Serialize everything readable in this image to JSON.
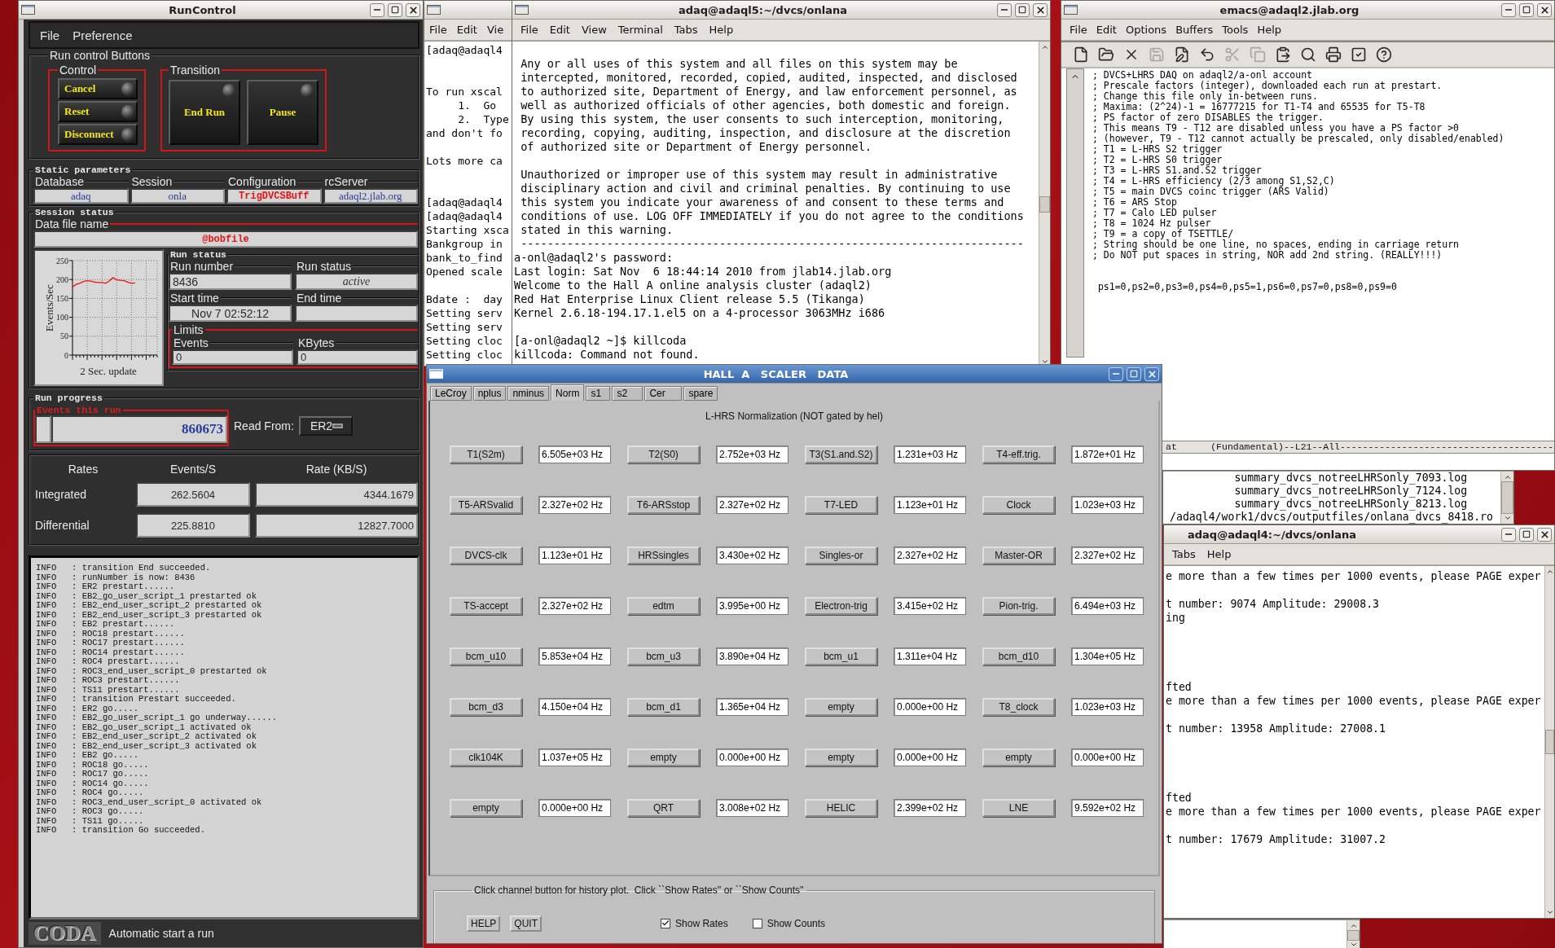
{
  "run_control": {
    "title": "RunControl",
    "menu": [
      "File",
      "Preference"
    ],
    "buttons_section": "Run control Buttons",
    "control": {
      "title": "Control",
      "buttons": [
        "Cancel",
        "Reset",
        "Disconnect"
      ]
    },
    "transition": {
      "title": "Transition",
      "buttons": [
        "End Run",
        "Pause"
      ]
    },
    "static_parameters": {
      "title": "Static parameters",
      "fields": [
        {
          "label": "Database",
          "value": "adaq",
          "emphasis": false
        },
        {
          "label": "Session",
          "value": "onla",
          "emphasis": false
        },
        {
          "label": "Configuration",
          "value": "TrigDVCSBuff",
          "emphasis": true
        },
        {
          "label": "rcServer",
          "value": "adaql2.jlab.org",
          "emphasis": false
        }
      ]
    },
    "session_status": {
      "title": "Session status",
      "data_file": {
        "label": "Data file name",
        "value": "@bobfile",
        "emphasis": true
      }
    },
    "rate_chart": {
      "chart_data": {
        "type": "line",
        "grid": true,
        "ylabel": "Events/Sec",
        "xlabel": "2 Sec. update",
        "categories": [
          null,
          null,
          null,
          null,
          null,
          null,
          null,
          null,
          null,
          null,
          null,
          null,
          null,
          null,
          null,
          null,
          null,
          null,
          null,
          null,
          null,
          null,
          null,
          null
        ],
        "values": [
          180,
          187,
          190,
          195,
          197,
          196,
          193,
          192,
          192,
          190,
          196,
          205,
          199,
          198,
          197,
          193,
          190,
          191,
          null,
          null,
          null,
          null,
          null,
          null
        ],
        "ylim": [
          0,
          250
        ],
        "yticks": [
          0,
          50,
          100,
          150,
          200,
          250
        ]
      }
    },
    "run_status": {
      "title": "Run status",
      "fields": [
        {
          "label": "Run number",
          "value": "8436",
          "kind": "number"
        },
        {
          "label": "Run status",
          "value": "active",
          "kind": "state"
        },
        {
          "label": "Start time",
          "value": "Nov 7 02:52:12",
          "kind": "time"
        },
        {
          "label": "End time",
          "kind": "time"
        }
      ]
    },
    "limits": {
      "title": "Limits",
      "fields": [
        {
          "label": "Events",
          "value": "0"
        },
        {
          "label": "KBytes",
          "value": "0"
        }
      ]
    },
    "run_progress": {
      "title": "Run progress",
      "events_label": "Events this run",
      "events_value": "860673",
      "read_from_label": "Read From:",
      "read_from_value": "ER2"
    },
    "rates": {
      "columns": [
        "Rates",
        "Events/S",
        "Rate (KB/S)"
      ],
      "rows": [
        {
          "name": "Integrated",
          "events": "262.5604",
          "rate": "4344.1679"
        },
        {
          "name": "Differential",
          "events": "225.8810",
          "rate": "12827.7000"
        }
      ]
    },
    "log": [
      "INFO   : transition End succeeded.",
      "INFO   : runNumber is now: 8436",
      "INFO   : ER2 prestart......",
      "INFO   : EB2_go_user_script_1 prestarted ok",
      "INFO   : EB2_end_user_script_2 prestarted ok",
      "INFO   : EB2_end_user_script_3 prestarted ok",
      "INFO   : EB2 prestart......",
      "INFO   : ROC18 prestart......",
      "INFO   : ROC17 prestart......",
      "INFO   : ROC14 prestart......",
      "INFO   : ROC4 prestart......",
      "INFO   : ROC3_end_user_script_0 prestarted ok",
      "INFO   : ROC3 prestart......",
      "INFO   : TS11 prestart......",
      "INFO   : transition Prestart succeeded.",
      "INFO   : ER2 go.....",
      "INFO   : EB2_go_user_script_1 go underway......",
      "INFO   : EB2_go_user_script_1 activated ok",
      "INFO   : EB2_end_user_script_2 activated ok",
      "INFO   : EB2_end_user_script_3 activated ok",
      "INFO   : EB2 go.....",
      "INFO   : ROC18 go.....",
      "INFO   : ROC17 go.....",
      "INFO   : ROC14 go.....",
      "INFO   : ROC4 go.....",
      "INFO   : ROC3_end_user_script_0 activated ok",
      "INFO   : ROC3 go.....",
      "INFO   : TS11 go.....",
      "INFO   : transition Go succeeded."
    ],
    "logo": "CODA",
    "status": "Automatic start a run"
  },
  "xterm_behind": {
    "menu": [
      "File",
      "Edit",
      "Vie"
    ],
    "lines": [
      {
        "kind": "text",
        "text": "[adaq@adaql4"
      },
      {
        "kind": "blank"
      },
      {
        "kind": "blank"
      },
      {
        "kind": "text",
        "text": "To run xscal"
      },
      {
        "kind": "text",
        "text": "     1.  Go"
      },
      {
        "kind": "text",
        "text": "     2.  Type"
      },
      {
        "kind": "text",
        "text": "and don't fo"
      },
      {
        "kind": "blank"
      },
      {
        "kind": "text",
        "text": "Lots more ca"
      },
      {
        "kind": "blank"
      },
      {
        "kind": "blank"
      },
      {
        "kind": "text",
        "text": "[adaq@adaql4"
      },
      {
        "kind": "text",
        "text": "[adaq@adaql4"
      },
      {
        "kind": "text",
        "text": "Starting xsca"
      },
      {
        "kind": "text",
        "text": "Bankgroup in"
      },
      {
        "kind": "text",
        "text": "bank_to_find"
      },
      {
        "kind": "text",
        "text": "Opened scale"
      },
      {
        "kind": "blank"
      },
      {
        "kind": "text",
        "text": "Bdate :  day"
      },
      {
        "kind": "text",
        "text": "Setting serv"
      },
      {
        "kind": "text",
        "text": "Setting serv"
      },
      {
        "kind": "text",
        "text": "Setting cloc"
      },
      {
        "kind": "text",
        "text": "Setting cloc"
      }
    ]
  },
  "terminal": {
    "title": "adaq@adaql5:~/dvcs/onlana",
    "menu": [
      "File",
      "Edit",
      "View",
      "Terminal",
      "Tabs",
      "Help"
    ],
    "lines": [
      {
        "kind": "blank"
      },
      {
        "kind": "text",
        "text": " Any or all uses of this system and all files on this system may be"
      },
      {
        "kind": "text",
        "text": " intercepted, monitored, recorded, copied, audited, inspected, and disclosed"
      },
      {
        "kind": "text",
        "text": " to authorized site, Department of Energy, and law enforcement personnel, as"
      },
      {
        "kind": "text",
        "text": " well as authorized officials of other agencies, both domestic and foreign."
      },
      {
        "kind": "text",
        "text": " By using this system, the user consents to such interception, monitoring,"
      },
      {
        "kind": "text",
        "text": " recording, copying, auditing, inspection, and disclosure at the discretion"
      },
      {
        "kind": "text",
        "text": " of authorized site or Department of Energy personnel."
      },
      {
        "kind": "blank"
      },
      {
        "kind": "text",
        "text": " Unauthorized or improper use of this system may result in administrative"
      },
      {
        "kind": "text",
        "text": " disciplinary action and civil and criminal penalties. By continuing to use"
      },
      {
        "kind": "text",
        "text": " this system you indicate your awareness of and consent to these terms and"
      },
      {
        "kind": "text",
        "text": " conditions of use. LOG OFF IMMEDIATELY if you do not agree to the conditions"
      },
      {
        "kind": "text",
        "text": " stated in this warning."
      },
      {
        "kind": "text",
        "text": " ----------------------------------------------------------------------------"
      },
      {
        "kind": "text",
        "text": "a-onl@adaql2's password:"
      },
      {
        "kind": "text",
        "text": "Last login: Sat Nov  6 18:44:14 2010 from jlab14.jlab.org"
      },
      {
        "kind": "text",
        "text": "Welcome to the Hall A online analysis cluster (adaql2)"
      },
      {
        "kind": "text",
        "text": "Red Hat Enterprise Linux Client release 5.5 (Tikanga)"
      },
      {
        "kind": "text",
        "text": "Kernel 2.6.18-194.17.1.el5 on a 4-processor 3063MHz i686"
      },
      {
        "kind": "blank"
      },
      {
        "kind": "text",
        "text": "[a-onl@adaql2 ~]$ killcoda"
      },
      {
        "kind": "text",
        "text": "killcoda: Command not found."
      }
    ]
  },
  "emacs": {
    "title": "emacs@adaql2.jlab.org",
    "menu": [
      "File",
      "Edit",
      "Options",
      "Buffers",
      "Tools",
      "Help"
    ],
    "toolbar": [
      {
        "disabled": false
      },
      {
        "disabled": false
      },
      {
        "disabled": false
      },
      {
        "disabled": true
      },
      {
        "disabled": false
      },
      {
        "disabled": false
      },
      {
        "disabled": true
      },
      {
        "disabled": true
      },
      {
        "disabled": false
      },
      {
        "disabled": false
      },
      {
        "disabled": false
      },
      {
        "disabled": false
      },
      {
        "disabled": false
      }
    ],
    "lines": [
      {
        "kind": "text",
        "text": "; DVCS+LHRS DAQ on adaql2/a-onl account"
      },
      {
        "kind": "text",
        "text": "; Prescale factors (integer), downloaded each run at prestart."
      },
      {
        "kind": "text",
        "text": "; Change this file only in-between runs."
      },
      {
        "kind": "text",
        "text": "; Maxima: (2^24)-1 = 16777215 for T1-T4 and 65535 for T5-T8"
      },
      {
        "kind": "text",
        "text": "; PS factor of zero DISABLES the trigger."
      },
      {
        "kind": "text",
        "text": "; This means T9 - T12 are disabled unless you have a PS factor >0"
      },
      {
        "kind": "text",
        "text": "; (however, T9 - T12 cannot actually be prescaled, only disabled/enabled)"
      },
      {
        "kind": "text",
        "text": "; T1 = L-HRS S2 trigger"
      },
      {
        "kind": "text",
        "text": "; T2 = L-HRS S0 trigger"
      },
      {
        "kind": "text",
        "text": "; T3 = L-HRS S1.and.S2 trigger"
      },
      {
        "kind": "text",
        "text": "; T4 = L-HRS efficiency (2/3 among S1,S2,C)"
      },
      {
        "kind": "text",
        "text": "; T5 = main DVCS coinc trigger (ARS Valid)"
      },
      {
        "kind": "text",
        "text": "; T6 = ARS Stop"
      },
      {
        "kind": "text",
        "text": "; T7 = Calo LED pulser"
      },
      {
        "kind": "text",
        "text": "; T8 = 1024 Hz pulser"
      },
      {
        "kind": "text",
        "text": "; T9 = a copy of TSETTLE/"
      },
      {
        "kind": "text",
        "text": "; String should be one line, no spaces, ending in carriage return"
      },
      {
        "kind": "text",
        "text": "; Do NOT put spaces in string, NOR add 2nd string. (REALLY!!!)"
      },
      {
        "kind": "blank"
      },
      {
        "kind": "blank"
      },
      {
        "kind": "text",
        "text": " ps1=0,ps2=0,ps3=0,ps4=0,ps5=1,ps6=0,ps7=0,ps8=0,ps9=0"
      }
    ],
    "modeline": "at      (Fundamental)--L21--All--------------------------------------"
  },
  "file_list": {
    "lines": [
      {
        "kind": "text",
        "text": "          summary_dvcs_notreeLHRSonly_7093.log"
      },
      {
        "kind": "text",
        "text": "          summary_dvcs_notreeLHRSonly_7124.log"
      },
      {
        "kind": "text",
        "text": "          summary_dvcs_notreeLHRSonly_8213.log"
      },
      {
        "kind": "text",
        "text": "/adaql4/work1/dvcs/outputfiles/onlana_dvcs_8418.ro"
      }
    ]
  },
  "terminal_2": {
    "title": "adaq@adaql4:~/dvcs/onlana",
    "menu": [
      "Tabs",
      "Help"
    ],
    "lines": [
      {
        "kind": "text",
        "text": "e more than a few times per 1000 events, please PAGE exper"
      },
      {
        "kind": "blank"
      },
      {
        "kind": "text",
        "text": "t number: 9074 Amplitude: 29008.3"
      },
      {
        "kind": "text",
        "text": "ing"
      },
      {
        "kind": "blank"
      },
      {
        "kind": "blank"
      },
      {
        "kind": "blank"
      },
      {
        "kind": "blank"
      },
      {
        "kind": "text",
        "text": "fted"
      },
      {
        "kind": "text",
        "text": "e more than a few times per 1000 events, please PAGE exper"
      },
      {
        "kind": "blank"
      },
      {
        "kind": "text",
        "text": "t number: 13958 Amplitude: 27008.1"
      },
      {
        "kind": "blank"
      },
      {
        "kind": "blank"
      },
      {
        "kind": "blank"
      },
      {
        "kind": "blank"
      },
      {
        "kind": "text",
        "text": "fted"
      },
      {
        "kind": "text",
        "text": "e more than a few times per 1000 events, please PAGE exper"
      },
      {
        "kind": "blank"
      },
      {
        "kind": "text",
        "text": "t number: 17679 Amplitude: 31007.2"
      }
    ]
  },
  "scaler": {
    "title": "HALL  A   SCALER   DATA",
    "tabs": [
      {
        "label": "LeCroy",
        "selected": false
      },
      {
        "label": "nplus",
        "selected": false
      },
      {
        "label": "nminus",
        "selected": false
      },
      {
        "label": "Norm",
        "selected": true
      },
      {
        "label": "s1",
        "selected": false
      },
      {
        "label": "s2",
        "selected": false
      },
      {
        "label": "Cer",
        "selected": false
      },
      {
        "label": "spare",
        "selected": false
      }
    ],
    "heading": "L-HRS Normalization (NOT gated by hel)",
    "channels": [
      {
        "name": "T1(S2m)",
        "rate": "6.505e+03 Hz"
      },
      {
        "name": "T2(S0)",
        "rate": "2.752e+03 Hz"
      },
      {
        "name": "T3(S1.and.S2)",
        "rate": "1.231e+03 Hz"
      },
      {
        "name": "T4-eff.trig.",
        "rate": "1.872e+01 Hz"
      },
      {
        "name": "T5-ARSvalid",
        "rate": "2.327e+02 Hz"
      },
      {
        "name": "T6-ARSstop",
        "rate": "2.327e+02 Hz"
      },
      {
        "name": "T7-LED",
        "rate": "1.123e+01 Hz"
      },
      {
        "name": "Clock",
        "rate": "1.023e+03 Hz"
      },
      {
        "name": "DVCS-clk",
        "rate": "1.123e+01 Hz"
      },
      {
        "name": "HRSsingles",
        "rate": "3.430e+02 Hz"
      },
      {
        "name": "Singles-or",
        "rate": "2.327e+02 Hz"
      },
      {
        "name": "Master-OR",
        "rate": "2.327e+02 Hz"
      },
      {
        "name": "TS-accept",
        "rate": "2.327e+02 Hz"
      },
      {
        "name": "edtm",
        "rate": "3.995e+00 Hz"
      },
      {
        "name": "Electron-trig",
        "rate": "3.415e+02 Hz"
      },
      {
        "name": "Pion-trig.",
        "rate": "6.494e+03 Hz"
      },
      {
        "name": "bcm_u10",
        "rate": "5.853e+04 Hz"
      },
      {
        "name": "bcm_u3",
        "rate": "3.890e+04 Hz"
      },
      {
        "name": "bcm_u1",
        "rate": "1.311e+04 Hz"
      },
      {
        "name": "bcm_d10",
        "rate": "1.304e+05 Hz"
      },
      {
        "name": "bcm_d3",
        "rate": "4.150e+04 Hz"
      },
      {
        "name": "bcm_d1",
        "rate": "1.365e+04 Hz"
      },
      {
        "name": "empty",
        "rate": "0.000e+00 Hz"
      },
      {
        "name": "T8_clock",
        "rate": "1.023e+03 Hz"
      },
      {
        "name": "clk104K",
        "rate": "1.037e+05 Hz"
      },
      {
        "name": "empty",
        "rate": "0.000e+00 Hz"
      },
      {
        "name": "empty",
        "rate": "0.000e+00 Hz"
      },
      {
        "name": "empty",
        "rate": "0.000e+00 Hz"
      },
      {
        "name": "empty",
        "rate": "0.000e+00 Hz"
      },
      {
        "name": "QRT",
        "rate": "3.008e+02 Hz"
      },
      {
        "name": "HELIC",
        "rate": "2.399e+02 Hz"
      },
      {
        "name": "LNE",
        "rate": "9.592e+02 Hz"
      }
    ],
    "footer": {
      "legend": "Click channel button for history plot.  Click ``Show Rates'' or ``Show Counts''",
      "buttons": [
        "HELP",
        "QUIT"
      ],
      "options": [
        {
          "label": "Show Rates",
          "checked": true
        },
        {
          "label": "Show Counts",
          "checked": false
        }
      ]
    }
  }
}
